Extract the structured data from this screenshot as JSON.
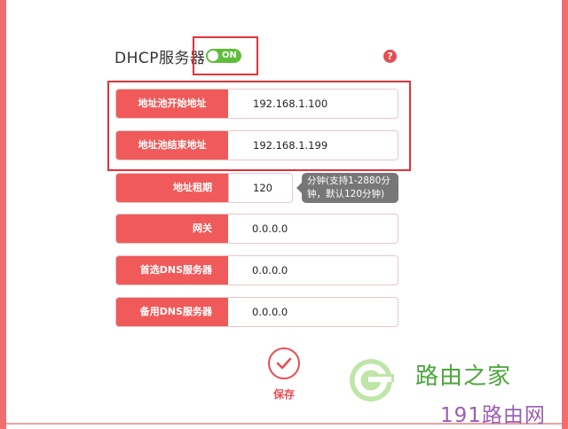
{
  "dhcp": {
    "label": "DHCP服务器",
    "toggle_text": "ON",
    "enabled": true,
    "help_symbol": "?"
  },
  "fields": {
    "start_address": {
      "label": "地址池开始地址",
      "value": "192.168.1.100"
    },
    "end_address": {
      "label": "地址池结束地址",
      "value": "192.168.1.199"
    },
    "lease_time": {
      "label": "地址租期",
      "value": "120",
      "hint_line1": "分钟(支持1-2880分",
      "hint_line2": "钟，默认120分钟)"
    },
    "gateway": {
      "label": "网关",
      "value": "0.0.0.0"
    },
    "primary_dns": {
      "label": "首选DNS服务器",
      "value": "0.0.0.0"
    },
    "secondary_dns": {
      "label": "备用DNS服务器",
      "value": "0.0.0.0"
    }
  },
  "save": {
    "label": "保存"
  },
  "watermark": {
    "text1": "路由之家",
    "text2": "191路由网"
  },
  "colors": {
    "accent": "#f05a5a",
    "toggle_on": "#5fbf3a",
    "highlight": "#e0343a",
    "border": "#f26d6d"
  }
}
